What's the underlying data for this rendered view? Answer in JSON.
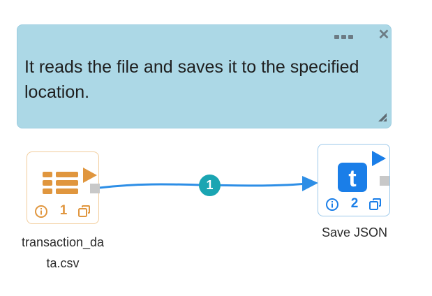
{
  "note": {
    "text": "It reads the file and saves it to the specified location.",
    "menu_icon": "ellipsis-icon",
    "close_icon": "close-icon",
    "resize_icon": "resize-handle-icon"
  },
  "nodes": [
    {
      "id": "node-a",
      "icon": "table-file-icon",
      "run_icon": "play-icon",
      "count": "1",
      "label_line1": "transaction_da",
      "label_line2": "ta.csv",
      "accent": "#e0963e"
    },
    {
      "id": "node-b",
      "icon": "t-letter-icon",
      "run_icon": "play-icon",
      "count": "2",
      "label": "Save JSON",
      "accent": "#1a7ee8"
    }
  ],
  "connection": {
    "badge": "1",
    "color": "#2d8ee6",
    "badge_color": "#1aa5b2"
  }
}
